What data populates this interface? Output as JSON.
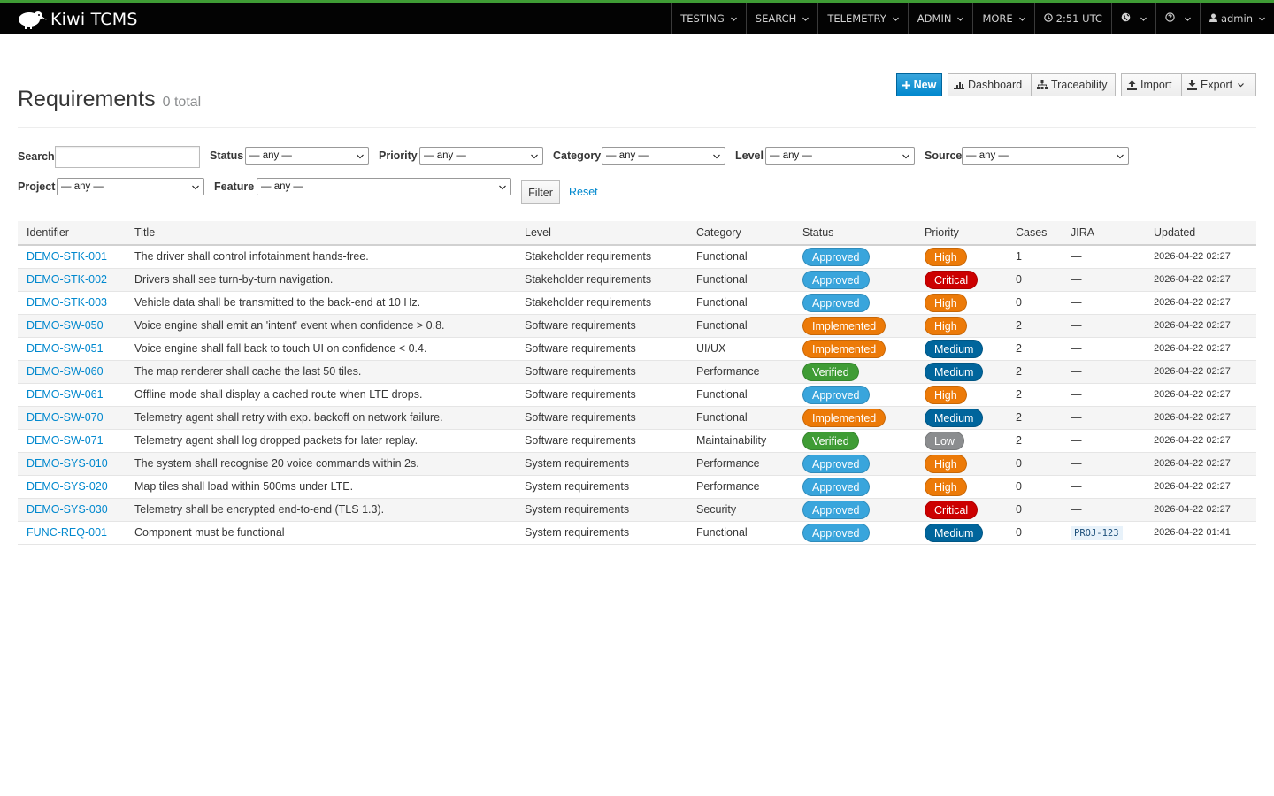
{
  "brand": {
    "name": "Kiwi TCMS"
  },
  "nav": [
    {
      "label": "TESTING",
      "caret": true
    },
    {
      "label": "SEARCH",
      "caret": true
    },
    {
      "label": "TELEMETRY",
      "caret": true
    },
    {
      "label": "ADMIN",
      "caret": true
    },
    {
      "label": "MORE",
      "caret": true
    },
    {
      "label": "2:51 UTC",
      "icon": "clock-icon",
      "caret": false
    },
    {
      "label": "",
      "icon": "globe-icon",
      "caret": true
    },
    {
      "label": "",
      "icon": "help-icon",
      "caret": true
    },
    {
      "label": "admin",
      "icon": "user-icon",
      "caret": true
    }
  ],
  "page": {
    "title": "Requirements",
    "count": "0 total"
  },
  "toolbar": {
    "new_label": "New",
    "dashboard_label": "Dashboard",
    "traceability_label": "Traceability",
    "import_label": "Import",
    "export_label": "Export"
  },
  "filters": {
    "search_label": "Search",
    "search_value": "",
    "status_label": "Status",
    "priority_label": "Priority",
    "category_label": "Category",
    "level_label": "Level",
    "source_label": "Source",
    "project_label": "Project",
    "feature_label": "Feature",
    "any_option": "— any —",
    "filter_button": "Filter",
    "reset_link": "Reset"
  },
  "table": {
    "columns": [
      "Identifier",
      "Title",
      "Level",
      "Category",
      "Status",
      "Priority",
      "Cases",
      "JIRA",
      "Updated"
    ],
    "rows": [
      {
        "id": "DEMO-STK-001",
        "title": "The driver shall control infotainment hands-free.",
        "level": "Stakeholder requirements",
        "category": "Functional",
        "status": "Approved",
        "priority": "High",
        "cases": "1",
        "jira": "—",
        "updated": "2026-04-22 02:27"
      },
      {
        "id": "DEMO-STK-002",
        "title": "Drivers shall see turn-by-turn navigation.",
        "level": "Stakeholder requirements",
        "category": "Functional",
        "status": "Approved",
        "priority": "Critical",
        "cases": "0",
        "jira": "—",
        "updated": "2026-04-22 02:27"
      },
      {
        "id": "DEMO-STK-003",
        "title": "Vehicle data shall be transmitted to the back-end at 10 Hz.",
        "level": "Stakeholder requirements",
        "category": "Functional",
        "status": "Approved",
        "priority": "High",
        "cases": "0",
        "jira": "—",
        "updated": "2026-04-22 02:27"
      },
      {
        "id": "DEMO-SW-050",
        "title": "Voice engine shall emit an 'intent' event when confidence > 0.8.",
        "level": "Software requirements",
        "category": "Functional",
        "status": "Implemented",
        "priority": "High",
        "cases": "2",
        "jira": "—",
        "updated": "2026-04-22 02:27"
      },
      {
        "id": "DEMO-SW-051",
        "title": "Voice engine shall fall back to touch UI on confidence < 0.4.",
        "level": "Software requirements",
        "category": "UI/UX",
        "status": "Implemented",
        "priority": "Medium",
        "cases": "2",
        "jira": "—",
        "updated": "2026-04-22 02:27"
      },
      {
        "id": "DEMO-SW-060",
        "title": "The map renderer shall cache the last 50 tiles.",
        "level": "Software requirements",
        "category": "Performance",
        "status": "Verified",
        "priority": "Medium",
        "cases": "2",
        "jira": "—",
        "updated": "2026-04-22 02:27"
      },
      {
        "id": "DEMO-SW-061",
        "title": "Offline mode shall display a cached route when LTE drops.",
        "level": "Software requirements",
        "category": "Functional",
        "status": "Approved",
        "priority": "High",
        "cases": "2",
        "jira": "—",
        "updated": "2026-04-22 02:27"
      },
      {
        "id": "DEMO-SW-070",
        "title": "Telemetry agent shall retry with exp. backoff on network failure.",
        "level": "Software requirements",
        "category": "Functional",
        "status": "Implemented",
        "priority": "Medium",
        "cases": "2",
        "jira": "—",
        "updated": "2026-04-22 02:27"
      },
      {
        "id": "DEMO-SW-071",
        "title": "Telemetry agent shall log dropped packets for later replay.",
        "level": "Software requirements",
        "category": "Maintainability",
        "status": "Verified",
        "priority": "Low",
        "cases": "2",
        "jira": "—",
        "updated": "2026-04-22 02:27"
      },
      {
        "id": "DEMO-SYS-010",
        "title": "The system shall recognise 20 voice commands within 2s.",
        "level": "System requirements",
        "category": "Performance",
        "status": "Approved",
        "priority": "High",
        "cases": "0",
        "jira": "—",
        "updated": "2026-04-22 02:27"
      },
      {
        "id": "DEMO-SYS-020",
        "title": "Map tiles shall load within 500ms under LTE.",
        "level": "System requirements",
        "category": "Performance",
        "status": "Approved",
        "priority": "High",
        "cases": "0",
        "jira": "—",
        "updated": "2026-04-22 02:27"
      },
      {
        "id": "DEMO-SYS-030",
        "title": "Telemetry shall be encrypted end-to-end (TLS 1.3).",
        "level": "System requirements",
        "category": "Security",
        "status": "Approved",
        "priority": "Critical",
        "cases": "0",
        "jira": "—",
        "updated": "2026-04-22 02:27"
      },
      {
        "id": "FUNC-REQ-001",
        "title": "Component must be functional",
        "level": "System requirements",
        "category": "Functional",
        "status": "Approved",
        "priority": "Medium",
        "cases": "0",
        "jira": "PROJ-123",
        "updated": "2026-04-22 01:41"
      }
    ]
  },
  "colors": {
    "Approved": "#39a5dc",
    "Implemented": "#ec7a08",
    "Verified": "#3f9c35",
    "High": "#ec7a08",
    "Critical": "#cc0000",
    "Medium": "#00659c",
    "Low": "#8b8d8f",
    "link": "#0088ce"
  }
}
